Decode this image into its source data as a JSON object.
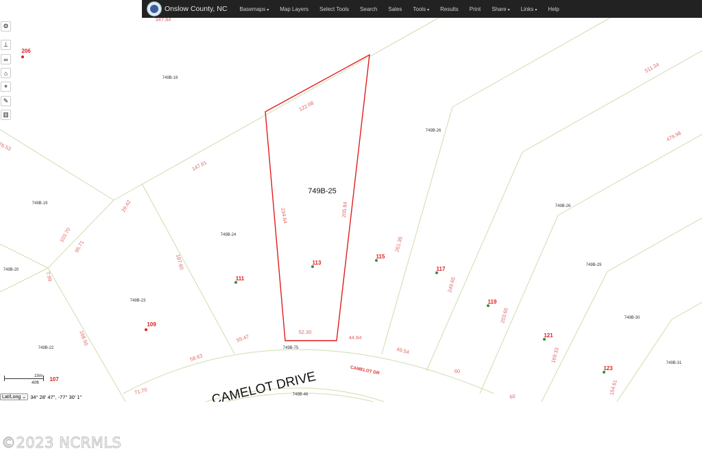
{
  "header": {
    "brand": "Onslow County, NC",
    "nav": [
      {
        "label": "Basemaps",
        "dropdown": true
      },
      {
        "label": "Map Layers",
        "dropdown": false
      },
      {
        "label": "Select Tools",
        "dropdown": false
      },
      {
        "label": "Search",
        "dropdown": false
      },
      {
        "label": "Sales",
        "dropdown": false
      },
      {
        "label": "Tools",
        "dropdown": true
      },
      {
        "label": "Results",
        "dropdown": false
      },
      {
        "label": "Print",
        "dropdown": false
      },
      {
        "label": "Share",
        "dropdown": true
      },
      {
        "label": "Links",
        "dropdown": true
      },
      {
        "label": "Help",
        "dropdown": false
      }
    ]
  },
  "toolbar": [
    {
      "name": "settings-icon",
      "glyph": "⚙"
    },
    {
      "name": "measure-icon",
      "glyph": "⊥"
    },
    {
      "name": "binoculars-icon",
      "glyph": "∞"
    },
    {
      "name": "home-icon",
      "glyph": "⌂"
    },
    {
      "name": "location-pin-icon",
      "glyph": "⌖"
    },
    {
      "name": "eraser-icon",
      "glyph": "✎"
    },
    {
      "name": "trash-icon",
      "glyph": "▥"
    }
  ],
  "map": {
    "selected_parcel": "749B-25",
    "street_label": "CAMELOT DRIVE",
    "street_label_small": "CAMELOT DR",
    "colors": {
      "parcel_line": "#c9d9a8",
      "dimension": "#e06666",
      "selected": "#e01b1b",
      "address": "#e01b1b",
      "point": "#3a8a3a"
    },
    "parcel_ids": [
      "749B-18",
      "749B-19",
      "749B-20",
      "749B-22",
      "749B-23",
      "749B-24",
      "749B-26",
      "749B-26",
      "749B-29",
      "749B-30",
      "749B-31",
      "749B-75",
      "749B-46"
    ],
    "dimensions": [
      "347.84",
      "76.53",
      "103.70",
      "95.71",
      "29.42",
      "147.61",
      "122.68",
      "234.64",
      "205.84",
      "187.60",
      "7.99",
      "168.50",
      "58.63",
      "55.47",
      "52.30",
      "44.84",
      "71.70",
      "261.35",
      "49.54",
      "60",
      "249.65",
      "511.34",
      "479.98",
      "203.65",
      "169.33",
      "154.61",
      "60"
    ],
    "addresses": [
      "206",
      "111",
      "113",
      "115",
      "117",
      "119",
      "109",
      "121",
      "123",
      "107"
    ]
  },
  "scale": {
    "metric": "10m",
    "imperial": "40ft"
  },
  "coords": {
    "mode": "Lat/Long",
    "value": "34° 28' 47\", -77° 30' 1\""
  },
  "watermark": "©2023 NCRMLS"
}
